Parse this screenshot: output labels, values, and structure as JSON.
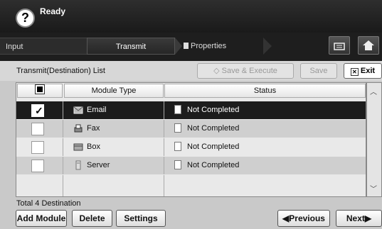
{
  "header": {
    "status": "Ready"
  },
  "tabs": {
    "input": "Input",
    "transmit": "Transmit",
    "properties": "Properties"
  },
  "toolbar": {
    "list_title": "Transmit(Destination) List",
    "save_execute": "Save & Execute",
    "save": "Save",
    "exit": "Exit"
  },
  "table": {
    "headers": {
      "module_type": "Module Type",
      "status": "Status"
    },
    "rows": [
      {
        "module": "Email",
        "status": "Not Completed",
        "icon": "email-icon",
        "checked": true
      },
      {
        "module": "Fax",
        "status": "Not Completed",
        "icon": "fax-icon",
        "checked": false
      },
      {
        "module": "Box",
        "status": "Not Completed",
        "icon": "box-icon",
        "checked": false
      },
      {
        "module": "Server",
        "status": "Not Completed",
        "icon": "server-icon",
        "checked": false
      }
    ]
  },
  "footer": {
    "total": "Total 4 Destination",
    "add_module": "Add Module",
    "delete": "Delete",
    "settings": "Settings",
    "previous": "Previous",
    "next": "Next"
  }
}
